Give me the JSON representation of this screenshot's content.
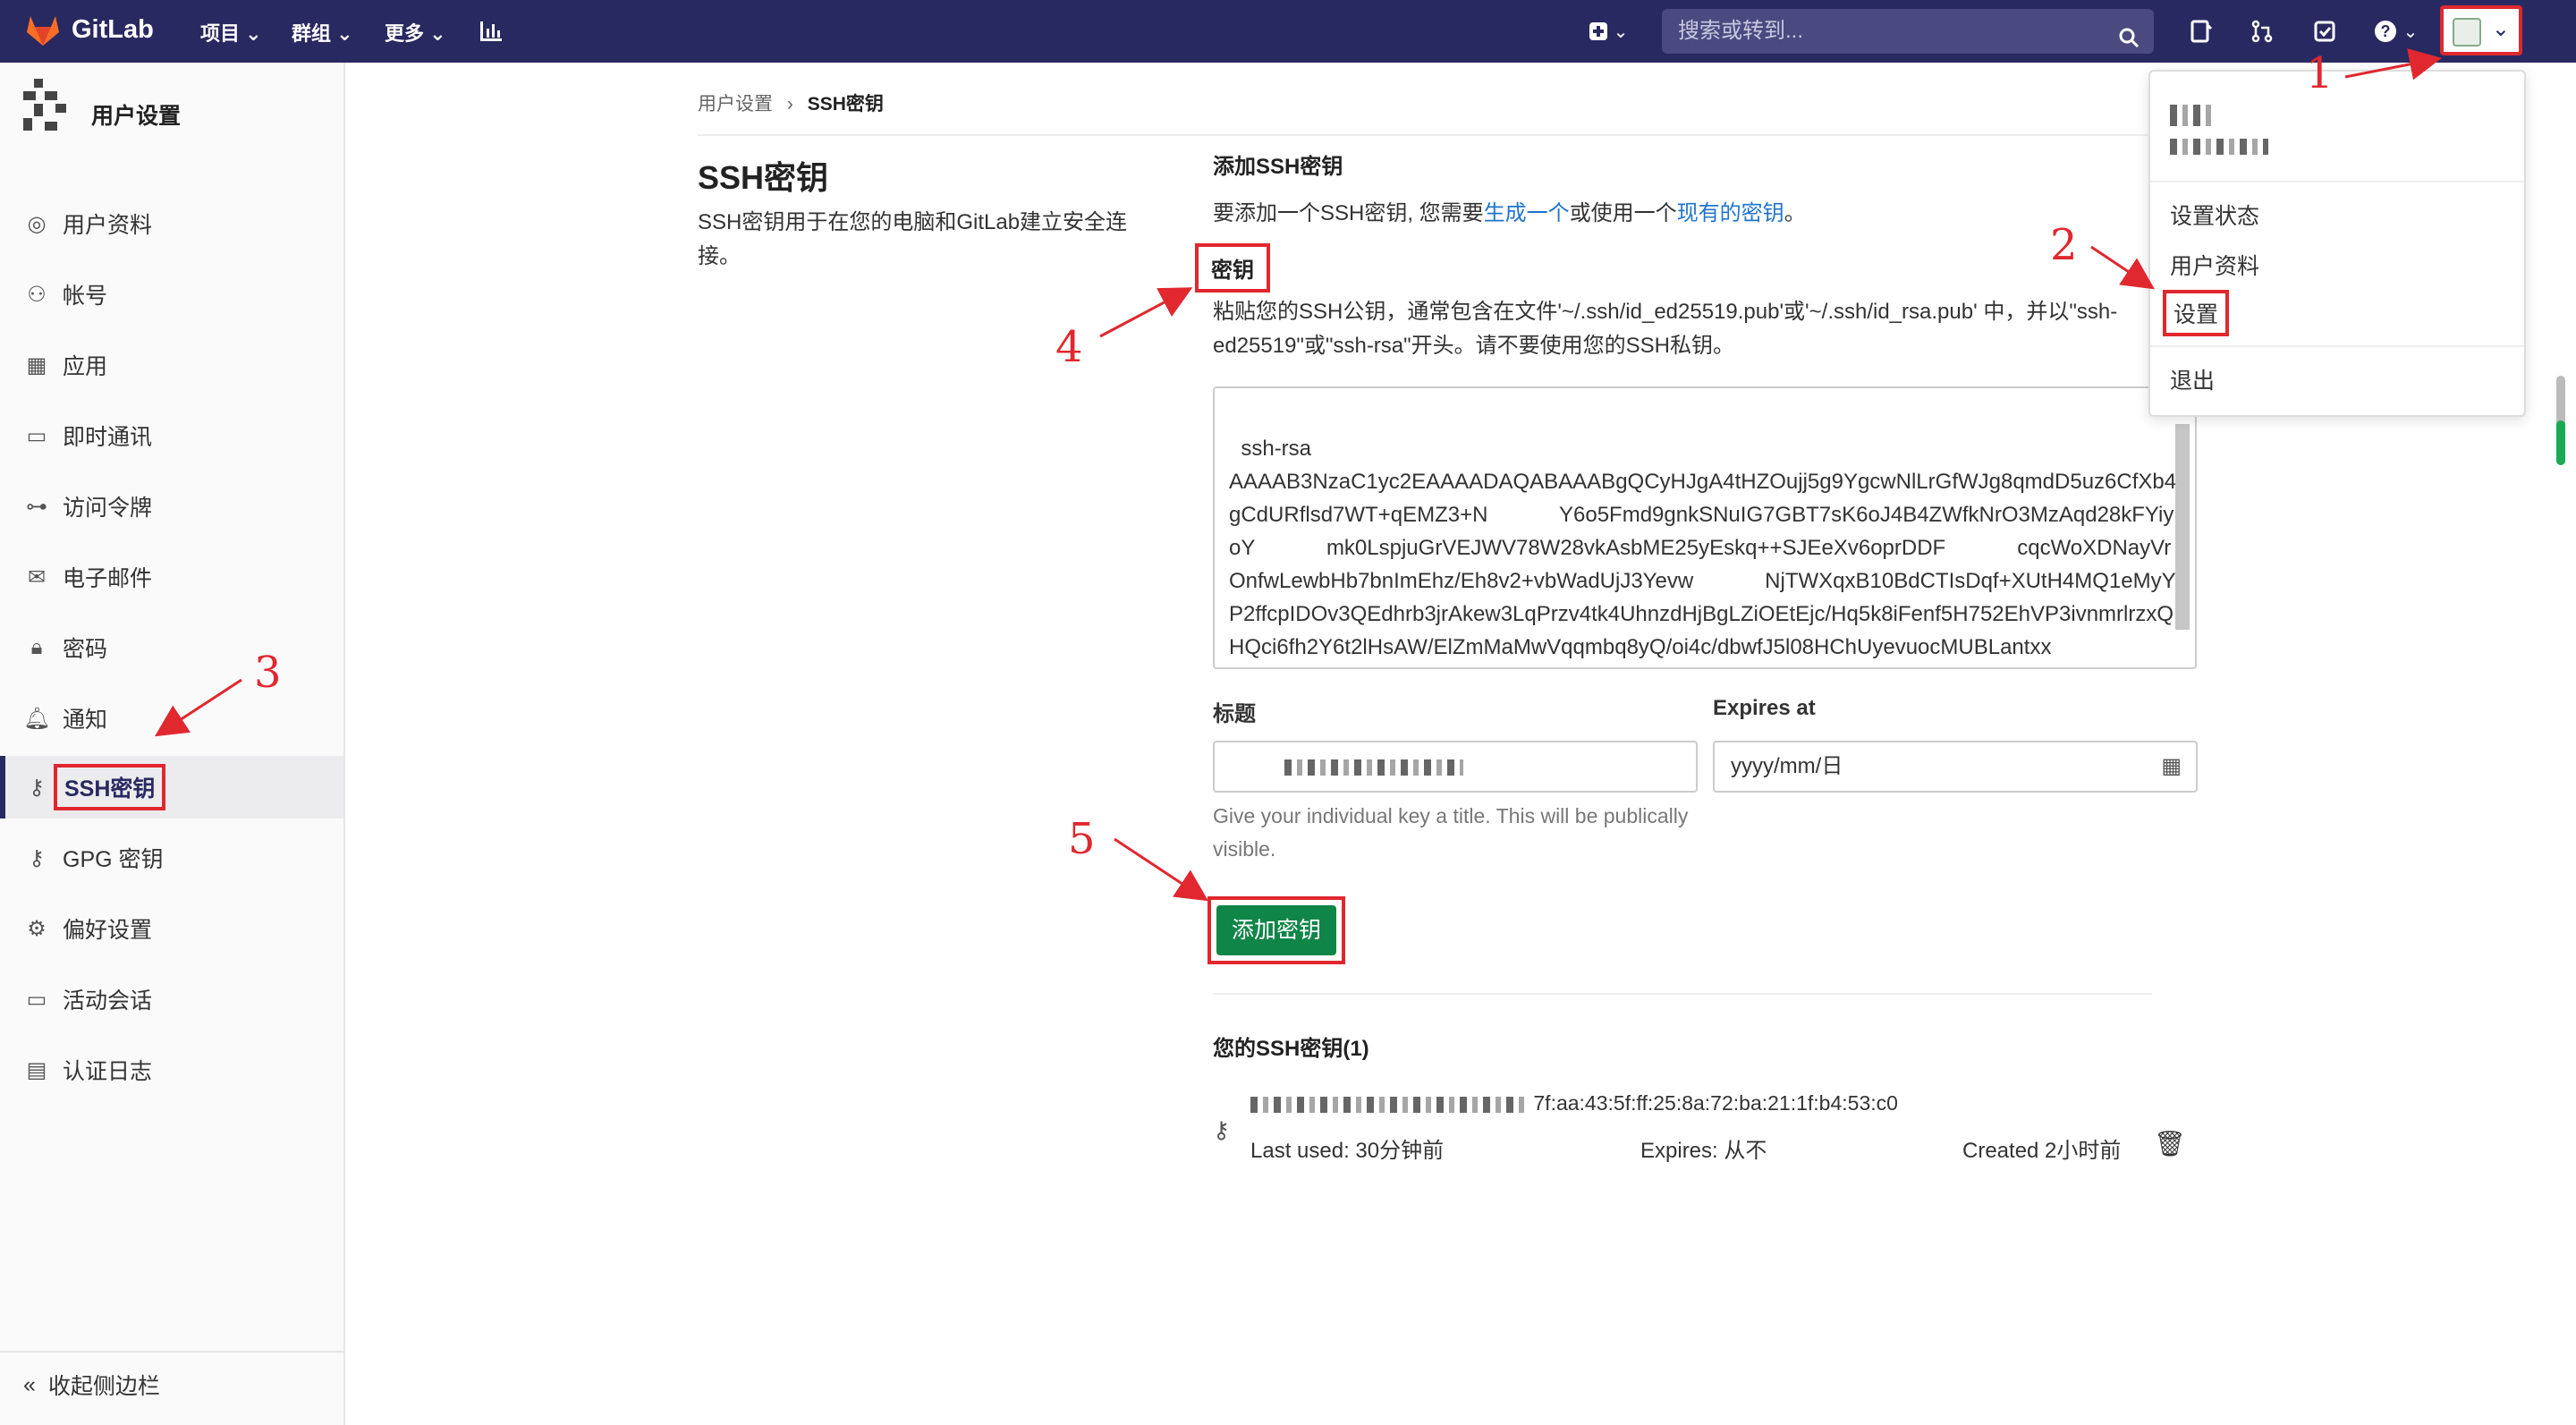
{
  "topbar": {
    "brand": "GitLab",
    "menus": [
      "项目",
      "群组",
      "更多"
    ],
    "search_placeholder": "搜索或转到..."
  },
  "sidebar": {
    "title": "用户设置",
    "items": [
      {
        "label": "用户资料",
        "icon": "profile-icon"
      },
      {
        "label": "帐号",
        "icon": "account-icon"
      },
      {
        "label": "应用",
        "icon": "applications-icon"
      },
      {
        "label": "即时通讯",
        "icon": "chat-icon"
      },
      {
        "label": "访问令牌",
        "icon": "token-icon"
      },
      {
        "label": "电子邮件",
        "icon": "email-icon"
      },
      {
        "label": "密码",
        "icon": "lock-icon"
      },
      {
        "label": "通知",
        "icon": "bell-icon"
      },
      {
        "label": "SSH密钥",
        "icon": "key-icon"
      },
      {
        "label": "GPG 密钥",
        "icon": "key-icon"
      },
      {
        "label": "偏好设置",
        "icon": "preferences-icon"
      },
      {
        "label": "活动会话",
        "icon": "monitor-icon"
      },
      {
        "label": "认证日志",
        "icon": "log-icon"
      }
    ],
    "active_index": 8,
    "collapse_label": "收起侧边栏"
  },
  "breadcrumb": {
    "parent": "用户设置",
    "sep": "›",
    "current": "SSH密钥"
  },
  "page": {
    "title": "SSH密钥",
    "description": "SSH密钥用于在您的电脑和GitLab建立安全连接。"
  },
  "form": {
    "section_title": "添加SSH密钥",
    "intro_prefix": "要添加一个SSH密钥, 您需要",
    "intro_link1": "生成一个",
    "intro_mid": "或使用一个",
    "intro_link2": "现有的密钥",
    "intro_suffix": "。",
    "key_label": "密钥",
    "key_hint": "粘贴您的SSH公钥，通常包含在文件'~/.ssh/id_ed25519.pub'或'~/.ssh/id_rsa.pub' 中，并以\"ssh-ed25519\"或\"ssh-rsa\"开头。请不要使用您的SSH私钥。",
    "key_value": "ssh-rsa\nAAAAB3NzaC1yc2EAAAADAQABAAABgQCyHJgA4tHZOujj5g9YgcwNlLrGfWJg8qmdD5uz6CfXb4gCdURflsd7WT+qEMZ3+N            Y6o5Fmd9gnkSNuIG7GBT7sK6oJ4B4ZWfkNrO3MzAqd28kFYiyoY            mk0LspjuGrVEJWV78W28vkAsbME25yEskq++SJEeXv6oprDDF            cqcWoXDNayVrOnfwLewbHb7bnImEhz/Eh8v2+vbWadUjJ3Yevw            NjTWXqxB10BdCTIsDqf+XUtH4MQ1eMyYP2ffcpIDOv3QEdhrb3jrAkew3LqPrzv4tk4UhnzdHjBgLZiOEtEjc/Hq5k8iFenf5H752EhVP3ivnmrlrzxQHQci6fh2Y6t2lHsAW/ElZmMaMwVqqmbq8yQ/oi4c/dbwfJ5l08HChUyevuocMUBLantxx",
    "title_label": "标题",
    "expires_label": "Expires at",
    "expires_placeholder": "yyyy/mm/日",
    "title_helper": "Give your individual key a title. This will be publically visible.",
    "submit_label": "添加密钥"
  },
  "keys": {
    "heading": "您的SSH密钥(1)",
    "items": [
      {
        "fingerprint_suffix": "7f:aa:43:5f:ff:25:8a:72:ba:21:1f:b4:53:c0",
        "last_used": "Last used: 30分钟前",
        "expires": "Expires: 从不",
        "created": "Created 2小时前"
      }
    ]
  },
  "user_menu": {
    "items": [
      "设置状态",
      "用户资料",
      "设置",
      "退出"
    ]
  },
  "annotations": [
    "1",
    "2",
    "3",
    "4",
    "5"
  ],
  "colors": {
    "topbar": "#292961",
    "highlight": "#e0282e",
    "primary_button": "#108548",
    "link": "#1f75cb"
  }
}
